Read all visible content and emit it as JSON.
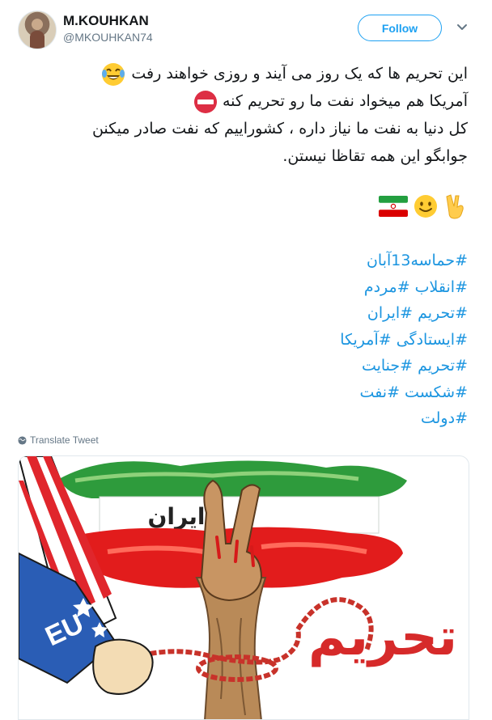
{
  "author": {
    "name": "M.KOUHKAN",
    "handle": "@MKOUHKAN74"
  },
  "follow_label": "Follow",
  "tweet_lines": [
    "این تحریم ها که یک روز می آیند و روزی خواهند رفت",
    "آمریکا هم میخواد نفت ما رو تحریم کنه",
    "کل دنیا به نفت ما نیاز داره ، کشوراییم که نفت صادر میکنن",
    "جوابگو این همه تقاظا نیستن."
  ],
  "emoji": {
    "line1": "laughing-tears-icon",
    "line2": "no-entry-icon",
    "row": [
      "iran-flag-icon",
      "smiley-icon",
      "victory-hand-icon"
    ]
  },
  "hashtags": [
    "#حماسه13آبان",
    "#انقلاب #مردم",
    "#تحریم #ایران",
    "#ایستادگی #آمریکا",
    "#تحریم #جنایت",
    "#شکست #نفت",
    "#دولت"
  ],
  "translate_label": "Translate Tweet",
  "image": {
    "flag_text": "ایران",
    "eu_text": "EU",
    "red_text": "تحریم"
  },
  "colors": {
    "accent": "#1da1f2",
    "hashtag": "#1b95e0",
    "muted": "#657786"
  }
}
